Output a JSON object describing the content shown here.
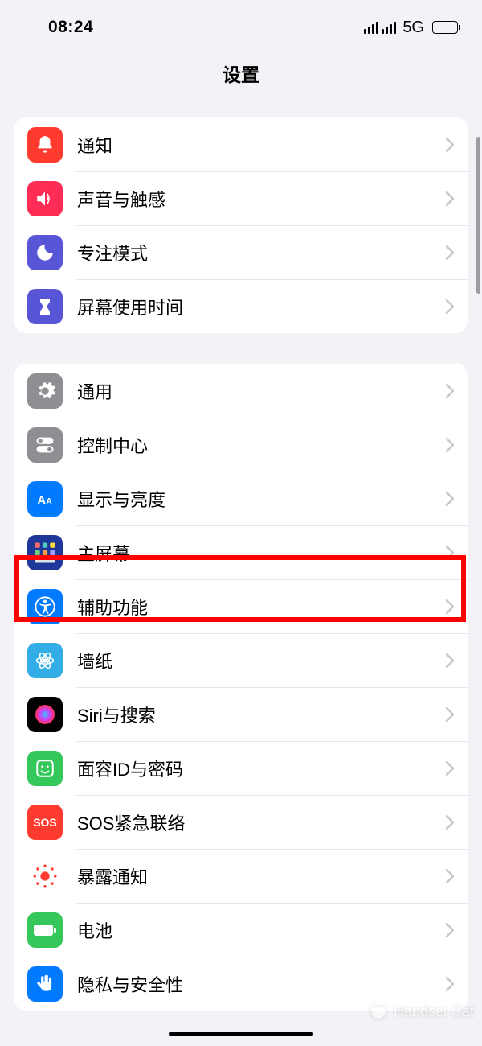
{
  "status": {
    "time": "08:24",
    "network": "5G"
  },
  "header": {
    "title": "设置"
  },
  "groups": [
    {
      "rows": [
        {
          "id": "notifications",
          "label": "通知",
          "icon": "bell-icon",
          "bg": "bg-red"
        },
        {
          "id": "sounds",
          "label": "声音与触感",
          "icon": "speaker-icon",
          "bg": "bg-pink"
        },
        {
          "id": "focus",
          "label": "专注模式",
          "icon": "moon-icon",
          "bg": "bg-purple"
        },
        {
          "id": "screentime",
          "label": "屏幕使用时间",
          "icon": "hourglass-icon",
          "bg": "bg-purple"
        }
      ]
    },
    {
      "rows": [
        {
          "id": "general",
          "label": "通用",
          "icon": "gear-icon",
          "bg": "bg-gray"
        },
        {
          "id": "control-center",
          "label": "控制中心",
          "icon": "toggles-icon",
          "bg": "bg-lgray"
        },
        {
          "id": "display",
          "label": "显示与亮度",
          "icon": "text-size-icon",
          "bg": "bg-blue"
        },
        {
          "id": "home-screen",
          "label": "主屏幕",
          "icon": "grid-icon",
          "bg": "bg-darkblue"
        },
        {
          "id": "accessibility",
          "label": "辅助功能",
          "icon": "accessibility-icon",
          "bg": "bg-blue",
          "highlight": true
        },
        {
          "id": "wallpaper",
          "label": "墙纸",
          "icon": "flower-icon",
          "bg": "bg-cyan"
        },
        {
          "id": "siri",
          "label": "Siri与搜索",
          "icon": "siri-icon",
          "bg": "bg-black"
        },
        {
          "id": "faceid",
          "label": "面容ID与密码",
          "icon": "face-icon",
          "bg": "bg-green"
        },
        {
          "id": "sos",
          "label": "SOS紧急联络",
          "icon": "sos-icon",
          "bg": "bg-red"
        },
        {
          "id": "exposure",
          "label": "暴露通知",
          "icon": "exposure-icon",
          "bg": "bg-dotred"
        },
        {
          "id": "battery",
          "label": "电池",
          "icon": "battery-icon",
          "bg": "bg-green"
        },
        {
          "id": "privacy",
          "label": "隐私与安全性",
          "icon": "hand-icon",
          "bg": "bg-hand"
        }
      ]
    }
  ],
  "watermark": {
    "text": "Handset Cat"
  }
}
